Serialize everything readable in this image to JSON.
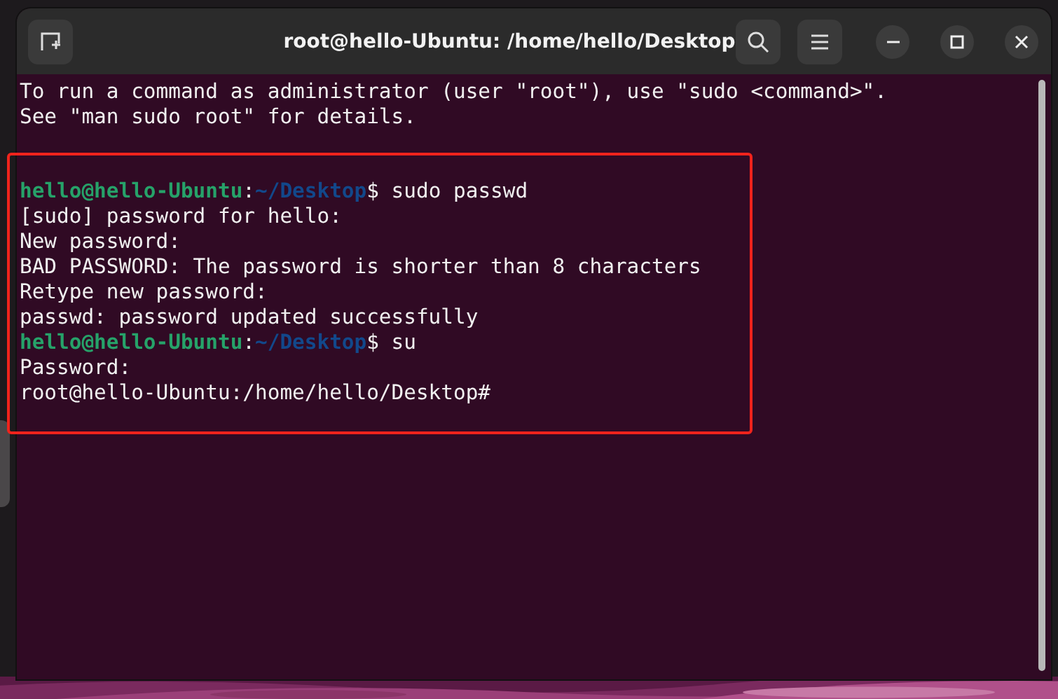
{
  "window": {
    "title": "root@hello-Ubuntu: /home/hello/Desktop"
  },
  "terminal": {
    "lines": [
      {
        "kind": "output",
        "text": "To run a command as administrator (user \"root\"), use \"sudo <command>\"."
      },
      {
        "kind": "output",
        "text": "See \"man sudo root\" for details."
      }
    ],
    "highlight_box": {
      "color": "#f0231c",
      "lines": [
        {
          "kind": "prompt",
          "user": "hello@hello-Ubuntu",
          "separator": ":",
          "path": "~/Desktop",
          "symbol": "$",
          "command": "sudo passwd"
        },
        {
          "kind": "output",
          "text": "[sudo] password for hello:"
        },
        {
          "kind": "output",
          "text": "New password:"
        },
        {
          "kind": "output",
          "text": "BAD PASSWORD: The password is shorter than 8 characters"
        },
        {
          "kind": "output",
          "text": "Retype new password:"
        },
        {
          "kind": "output",
          "text": "passwd: password updated successfully"
        },
        {
          "kind": "prompt",
          "user": "hello@hello-Ubuntu",
          "separator": ":",
          "path": "~/Desktop",
          "symbol": "$",
          "command": "su"
        },
        {
          "kind": "output",
          "text": "Password:"
        },
        {
          "kind": "output",
          "text": "root@hello-Ubuntu:/home/hello/Desktop#"
        }
      ]
    }
  }
}
